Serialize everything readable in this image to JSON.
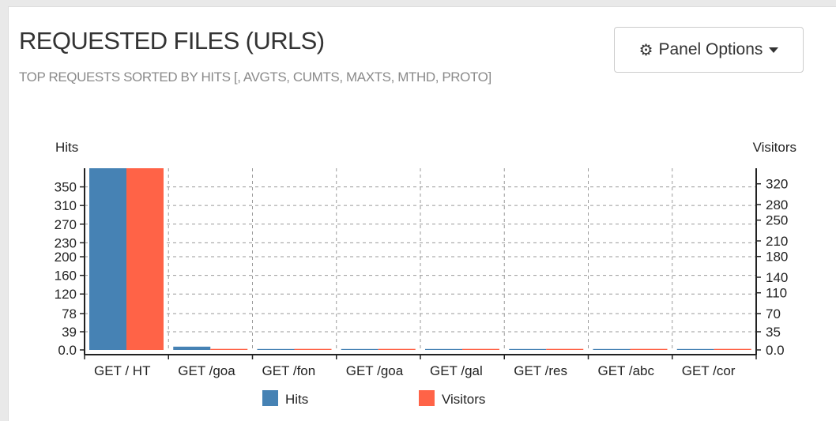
{
  "panel": {
    "title": "REQUESTED FILES (URLS)",
    "subtitle": "TOP REQUESTS SORTED BY HITS [, AVGTS, CUMTS, MAXTS, MTHD, PROTO]",
    "options_label": "Panel Options",
    "options_icon": "gear-icon"
  },
  "colors": {
    "hits": "#4682b4",
    "visitors": "#ff6347"
  },
  "chart_data": {
    "type": "bar",
    "categories": [
      "GET / HT",
      "GET /goa",
      "GET /fon",
      "GET /goa",
      "GET /gal",
      "GET /res",
      "GET /abc",
      "GET /cor"
    ],
    "series": [
      {
        "name": "Hits",
        "axis": "left",
        "values": [
          390,
          7,
          2,
          2,
          2,
          2,
          2,
          2
        ]
      },
      {
        "name": "Visitors",
        "axis": "right",
        "values": [
          350,
          2,
          2,
          2,
          2,
          2,
          2,
          2
        ]
      }
    ],
    "ylabel": "Hits",
    "y2label": "Visitors",
    "yticks": [
      "0.0",
      "39",
      "78",
      "120",
      "160",
      "200",
      "230",
      "270",
      "310",
      "350"
    ],
    "y2ticks": [
      "0.0",
      "35",
      "70",
      "110",
      "140",
      "180",
      "210",
      "250",
      "280",
      "320"
    ],
    "ylim": [
      0,
      390
    ],
    "y2lim": [
      0,
      350
    ],
    "grid": true,
    "legend": [
      "Hits",
      "Visitors"
    ],
    "legend_position": "bottom"
  }
}
